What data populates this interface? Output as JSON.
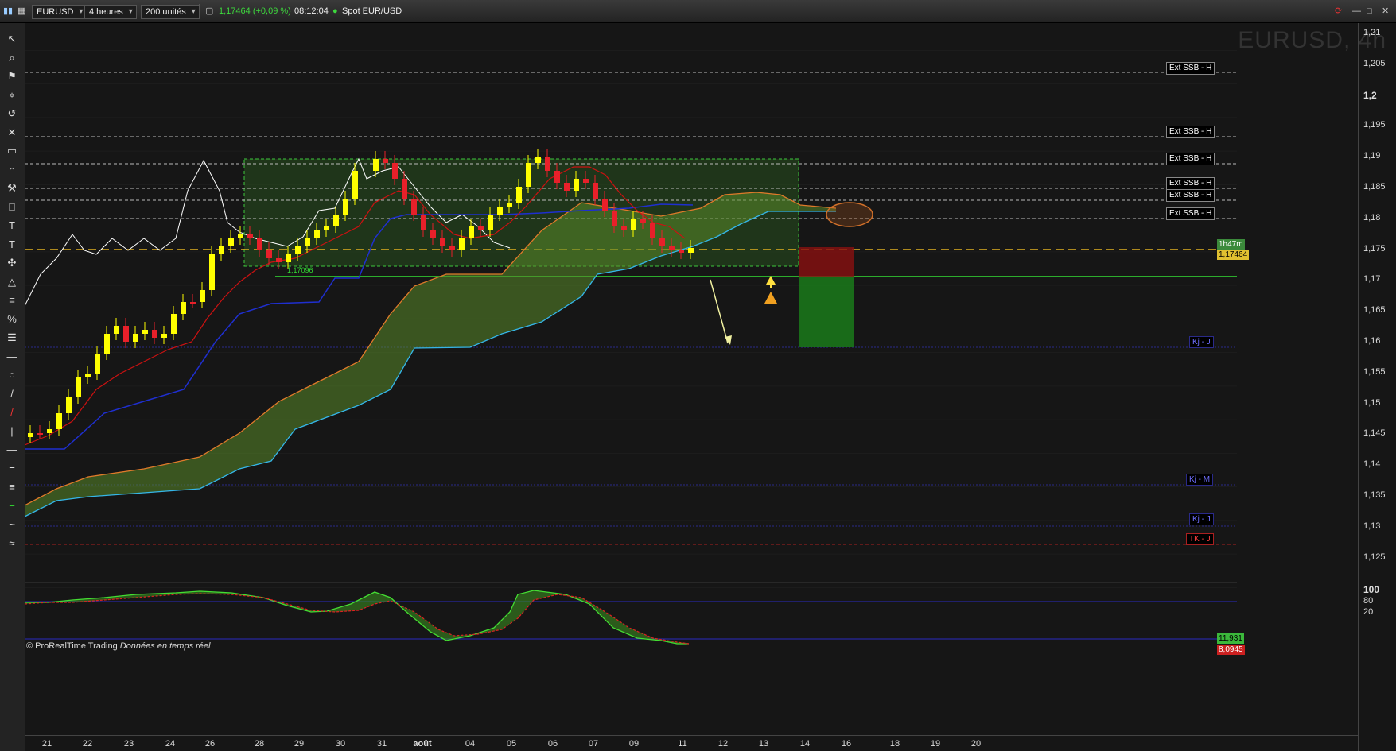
{
  "toolbar": {
    "symbol": "EURUSD",
    "timeframe": "4 heures",
    "units": "200 unités",
    "quote": "1,17464 (+0,09 %)",
    "time": "08:12:04",
    "instrument": "Spot EUR/USD"
  },
  "chart": {
    "watermark": "EURUSD, 4h",
    "credits_brand": "© ProRealTime Trading",
    "credits_feed": "Données en temps réel",
    "rect_label": "1,17096",
    "countdown": "1h47m",
    "last_price": "1,17464",
    "osc_value_1": "11,931",
    "osc_value_2": "8,0945"
  },
  "y_axis_labels": [
    "1,21",
    "1,205",
    "1,2",
    "1,195",
    "1,19",
    "1,185",
    "1,18",
    "1,175",
    "1,17",
    "1,165",
    "1,16",
    "1,155",
    "1,15",
    "1,145",
    "1,14",
    "1,135",
    "1,13",
    "1,125"
  ],
  "osc_axis_labels": [
    "100",
    "80",
    "20"
  ],
  "x_axis_labels": [
    "21",
    "22",
    "23",
    "24",
    "26",
    "28",
    "29",
    "30",
    "31",
    "août",
    "04",
    "05",
    "06",
    "07",
    "09",
    "11",
    "12",
    "13",
    "14",
    "16",
    "18",
    "19",
    "20"
  ],
  "level_tags": {
    "ssb_1": "Ext SSB - H",
    "ssb_2": "Ext SSB - H",
    "ssb_3": "Ext SSB - H",
    "ssb_4": "Ext SSB - H",
    "ssb_5": "Ext SSB - H",
    "ssb_6": "Ext SSB - H",
    "kj_j_1": "Kj - J",
    "kj_m": "Kj - M",
    "kj_j_2": "Kj - J",
    "tk_j": "TK - J"
  },
  "colors": {
    "bull_candle": "#ffff00",
    "bear_candle": "#e8202a",
    "tenkan": "#cc1111",
    "kijun": "#1f2fd0",
    "chikou": "#ffffff",
    "ssa": "#e07a2a",
    "ssb": "#35b6e8",
    "kumo": "#5a8a2a",
    "range_box": "#2a5a20"
  },
  "icons": [
    "arrow-cursor-icon",
    "zoom-icon",
    "alert-bell-icon",
    "magnifier-icon",
    "undo-icon",
    "eraser-icon",
    "ruler-icon",
    "magnet-icon",
    "tools-icon",
    "trash-icon",
    "text-icon",
    "text-round-icon",
    "move-icon",
    "fibonacci-icon",
    "fib-bars-icon",
    "percent-icon",
    "fan-icon",
    "segment-icon",
    "ellipse-icon",
    "line-icon",
    "red-line-icon",
    "vertical-line-icon",
    "horizontal-line-icon",
    "channel-icon",
    "pitchfork-icon",
    "green-line-icon",
    "wave-icon",
    "curve-icon"
  ]
}
